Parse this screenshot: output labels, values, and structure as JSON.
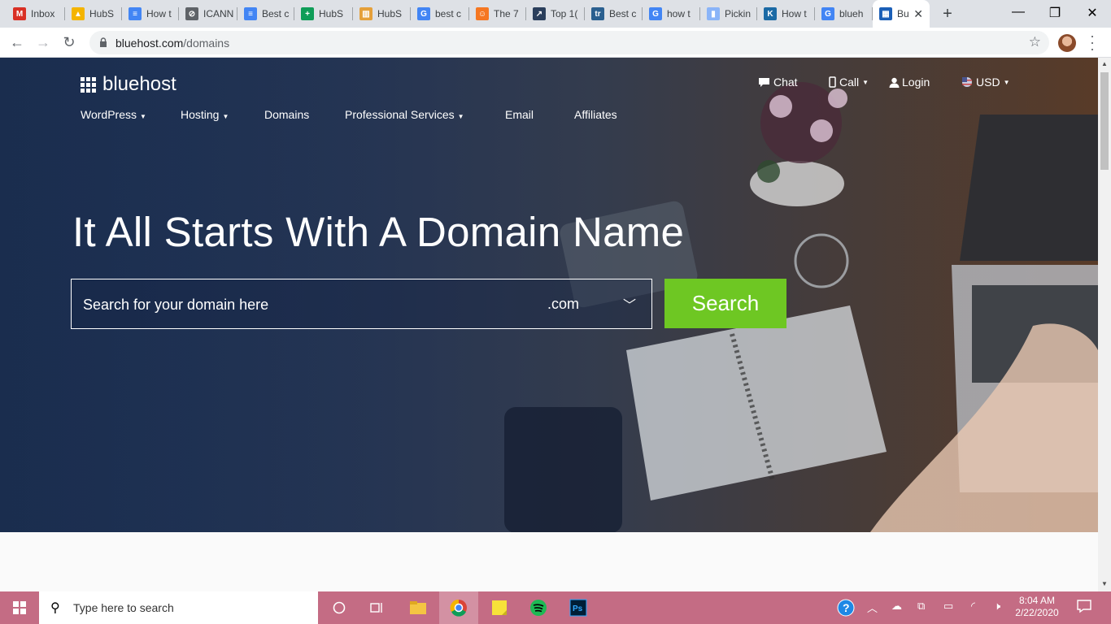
{
  "browser": {
    "tabs": [
      {
        "label": "Inbox",
        "icon": "gmail-icon",
        "color": "#d93025",
        "glyph": "M"
      },
      {
        "label": "HubS",
        "icon": "google-drive-icon",
        "color": "#f4b400",
        "glyph": "▲"
      },
      {
        "label": "How t",
        "icon": "google-docs-icon",
        "color": "#4285f4",
        "glyph": "≡"
      },
      {
        "label": "ICANN",
        "icon": "icann-icon",
        "color": "#5f6368",
        "glyph": "⊘"
      },
      {
        "label": "Best c",
        "icon": "google-docs-icon",
        "color": "#4285f4",
        "glyph": "≡"
      },
      {
        "label": "HubS",
        "icon": "google-sheets-icon",
        "color": "#0f9d58",
        "glyph": "+"
      },
      {
        "label": "HubS",
        "icon": "trello-icon",
        "color": "#e5a03a",
        "glyph": "▥"
      },
      {
        "label": "best c",
        "icon": "google-icon",
        "color": "#4285f4",
        "glyph": "G"
      },
      {
        "label": "The 7",
        "icon": "hubspot-icon",
        "color": "#f57722",
        "glyph": "☺"
      },
      {
        "label": "Top 1(",
        "icon": "chart-icon",
        "color": "#2b3f5c",
        "glyph": "↗"
      },
      {
        "label": "Best c",
        "icon": "techradar-icon",
        "color": "#2a5f8f",
        "glyph": "tr"
      },
      {
        "label": "how t",
        "icon": "google-icon",
        "color": "#4285f4",
        "glyph": "G"
      },
      {
        "label": "Pickin",
        "icon": "bookmark-icon",
        "color": "#8ab4f8",
        "glyph": "▮"
      },
      {
        "label": "How t",
        "icon": "kinsta-icon",
        "color": "#1b6aa5",
        "glyph": "K"
      },
      {
        "label": "blueh",
        "icon": "google-icon",
        "color": "#4285f4",
        "glyph": "G"
      },
      {
        "label": "Bu",
        "icon": "bluehost-icon",
        "color": "#1b5fb7",
        "glyph": "▦"
      }
    ],
    "url_domain": "bluehost.com",
    "url_path": "/domains"
  },
  "site": {
    "logo": "bluehost",
    "topnav": {
      "chat": "Chat",
      "call": "Call",
      "login": "Login",
      "currency": "USD"
    },
    "mainnav": [
      "WordPress",
      "Hosting",
      "Domains",
      "Professional Services",
      "Email",
      "Affiliates"
    ],
    "headline": "It All Starts With A Domain Name",
    "search": {
      "placeholder": "Search for your domain here",
      "tld": ".com",
      "button": "Search"
    }
  },
  "taskbar": {
    "search_placeholder": "Type here to search",
    "time": "8:04 AM",
    "date": "2/22/2020"
  },
  "colors": {
    "accent": "#6ec723",
    "hero": "#1f3357",
    "taskbar": "#c46c84"
  }
}
